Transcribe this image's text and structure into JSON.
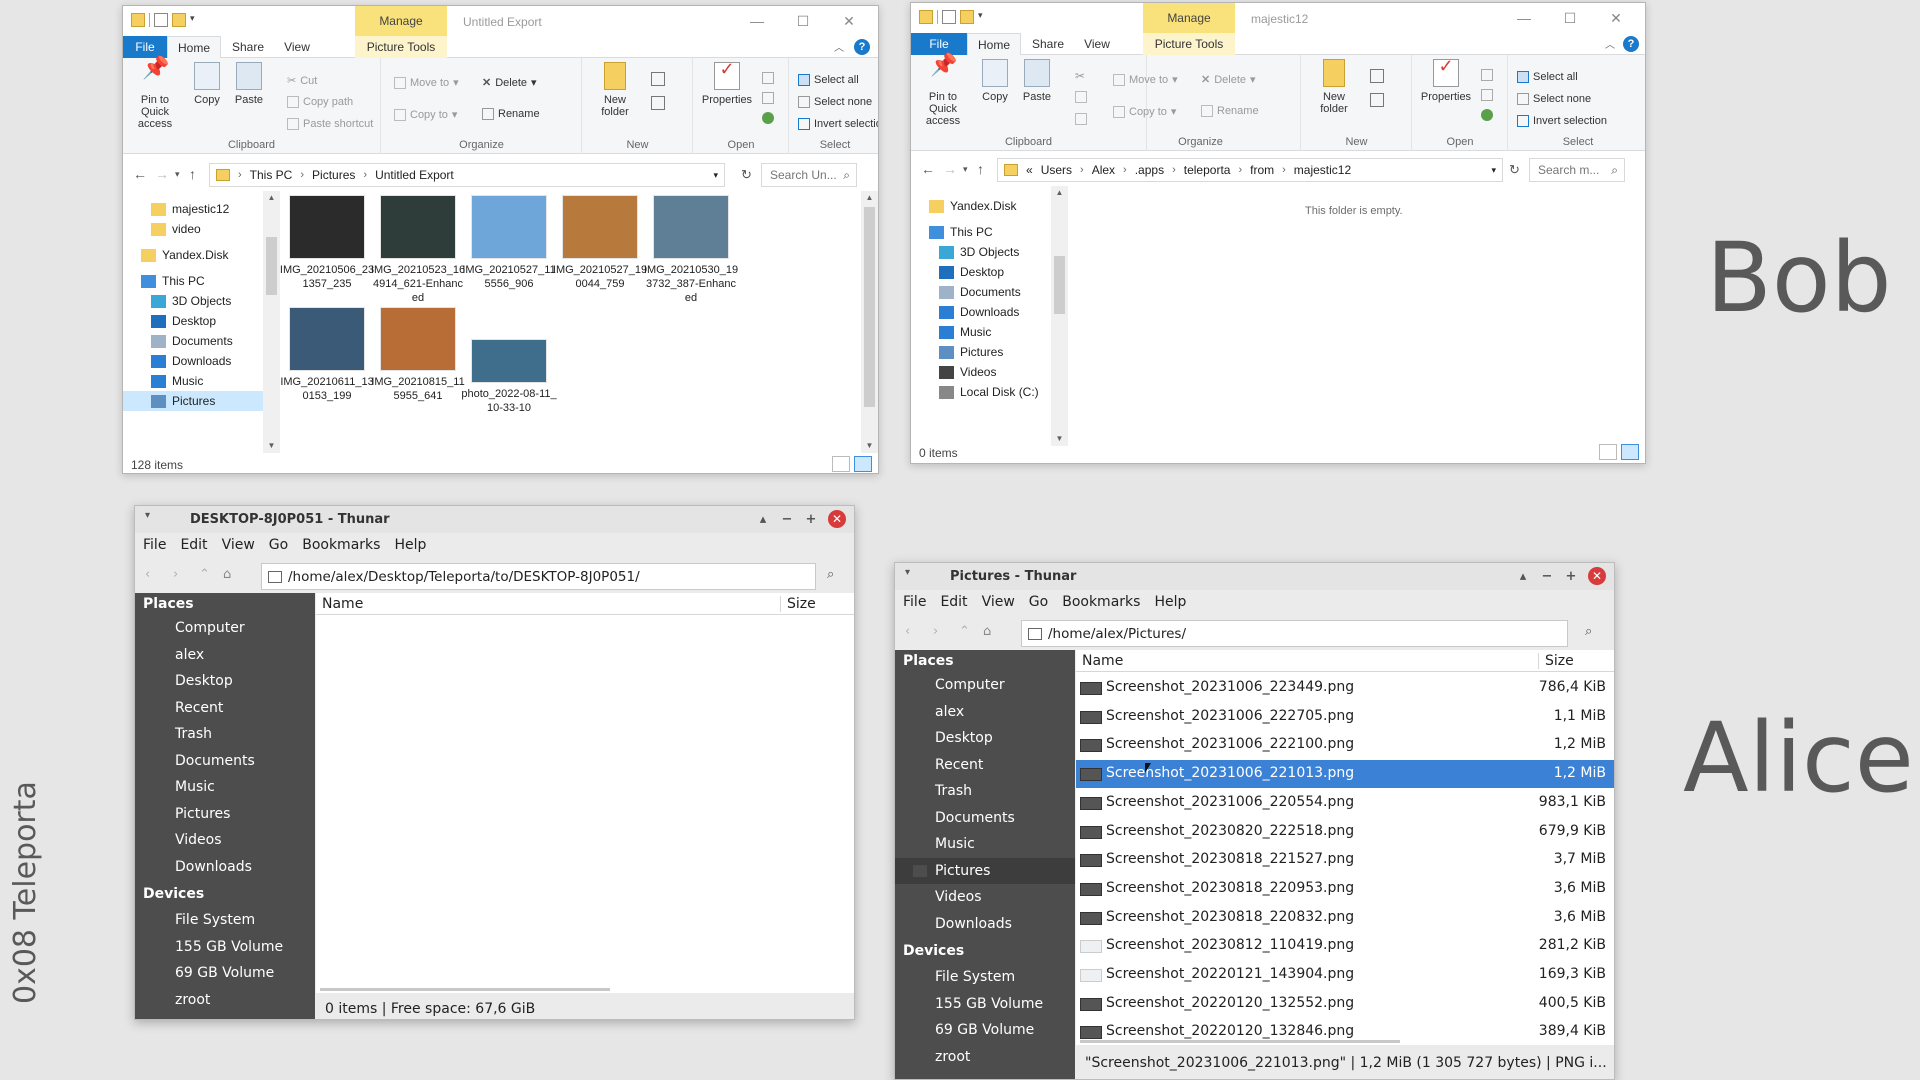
{
  "labels": {
    "bob": "Bob",
    "alice": "Alice",
    "teleporta": "0x08 Teleporta"
  },
  "explorer_common": {
    "tabs": {
      "file": "File",
      "home": "Home",
      "share": "Share",
      "view": "View",
      "picture_tools": "Picture Tools"
    },
    "manage": "Manage",
    "ribbon": {
      "pin": "Pin to Quick access",
      "copy": "Copy",
      "paste": "Paste",
      "cut": "Cut",
      "copy_path": "Copy path",
      "paste_shortcut": "Paste shortcut",
      "move_to": "Move to",
      "copy_to": "Copy to",
      "delete": "Delete",
      "rename": "Rename",
      "new_folder": "New folder",
      "properties": "Properties",
      "select_all": "Select all",
      "select_none": "Select none",
      "invert_selection": "Invert selection",
      "groups": {
        "clipboard": "Clipboard",
        "organize": "Organize",
        "new": "New",
        "open": "Open",
        "select": "Select"
      }
    }
  },
  "explorer1": {
    "title": "Untitled Export",
    "path": [
      "This PC",
      "Pictures",
      "Untitled Export"
    ],
    "search_placeholder": "Search Un...",
    "nav": [
      "majestic12",
      "video",
      "Yandex.Disk",
      "This PC",
      "3D Objects",
      "Desktop",
      "Documents",
      "Downloads",
      "Music",
      "Pictures"
    ],
    "files": [
      {
        "name": "IMG_20210506_231357_235",
        "color": "#2b2b2b"
      },
      {
        "name": "IMG_20210523_164914_621-Enhanced",
        "color": "#2f3d3a"
      },
      {
        "name": "IMG_20210527_115556_906",
        "color": "#6ea6d9"
      },
      {
        "name": "IMG_20210527_190044_759",
        "color": "#b77a3c"
      },
      {
        "name": "IMG_20210530_193732_387-Enhanced",
        "color": "#5f7f97"
      },
      {
        "name": "IMG_20210611_130153_199",
        "color": "#3b5a78"
      },
      {
        "name": "IMG_20210815_115955_641",
        "color": "#b86c36"
      },
      {
        "name": "photo_2022-08-11_10-33-10",
        "color": "#3f6d8c"
      }
    ],
    "status": "128 items"
  },
  "explorer2": {
    "title": "majestic12",
    "path": [
      "Users",
      "Alex",
      ".apps",
      "teleporta",
      "from",
      "majestic12"
    ],
    "path_prefix": "«",
    "search_placeholder": "Search m...",
    "nav": [
      "Yandex.Disk",
      "This PC",
      "3D Objects",
      "Desktop",
      "Documents",
      "Downloads",
      "Music",
      "Pictures",
      "Videos",
      "Local Disk (C:)"
    ],
    "empty": "This folder is empty.",
    "status": "0 items"
  },
  "thunar_common": {
    "menu": [
      "File",
      "Edit",
      "View",
      "Go",
      "Bookmarks",
      "Help"
    ],
    "places_heading": "Places",
    "places": [
      "Computer",
      "alex",
      "Desktop",
      "Recent",
      "Trash",
      "Documents",
      "Music",
      "Pictures",
      "Videos",
      "Downloads"
    ],
    "devices_heading": "Devices",
    "devices": [
      "File System",
      "155 GB Volume",
      "69 GB Volume",
      "zroot"
    ],
    "col_name": "Name",
    "col_size": "Size"
  },
  "thunar1": {
    "title": "DESKTOP-8J0P051 - Thunar",
    "location": "/home/alex/Desktop/Teleporta/to/DESKTOP-8J0P051/",
    "status": "0 items  |  Free space: 67,6 GiB"
  },
  "thunar2": {
    "title": "Pictures - Thunar",
    "location": "/home/alex/Pictures/",
    "files": [
      {
        "name": "Screenshot_20231006_223449.png",
        "size": "786,4 KiB",
        "icon": "dark"
      },
      {
        "name": "Screenshot_20231006_222705.png",
        "size": "1,1 MiB",
        "icon": "dark"
      },
      {
        "name": "Screenshot_20231006_222100.png",
        "size": "1,2 MiB",
        "icon": "dark"
      },
      {
        "name": "Screenshot_20231006_221013.png",
        "size": "1,2 MiB",
        "icon": "dark",
        "selected": true
      },
      {
        "name": "Screenshot_20231006_220554.png",
        "size": "983,1 KiB",
        "icon": "dark"
      },
      {
        "name": "Screenshot_20230820_222518.png",
        "size": "679,9 KiB",
        "icon": "dark"
      },
      {
        "name": "Screenshot_20230818_221527.png",
        "size": "3,7 MiB",
        "icon": "dark"
      },
      {
        "name": "Screenshot_20230818_220953.png",
        "size": "3,6 MiB",
        "icon": "dark"
      },
      {
        "name": "Screenshot_20230818_220832.png",
        "size": "3,6 MiB",
        "icon": "dark"
      },
      {
        "name": "Screenshot_20230812_110419.png",
        "size": "281,2 KiB",
        "icon": "light"
      },
      {
        "name": "Screenshot_20220121_143904.png",
        "size": "169,3 KiB",
        "icon": "light"
      },
      {
        "name": "Screenshot_20220120_132552.png",
        "size": "400,5 KiB",
        "icon": "dark"
      },
      {
        "name": "Screenshot_20220120_132846.png",
        "size": "389,4 KiB",
        "icon": "dark"
      }
    ],
    "status": "\"Screenshot_20231006_221013.png\"  |  1,2 MiB (1 305 727 bytes)  |  PNG i..."
  },
  "colors": {
    "accent": "#1979ca",
    "selection": "#3b82d6",
    "places_bg": "#4d4d4d",
    "close": "#d83b3b",
    "manage": "#f9e27b"
  }
}
